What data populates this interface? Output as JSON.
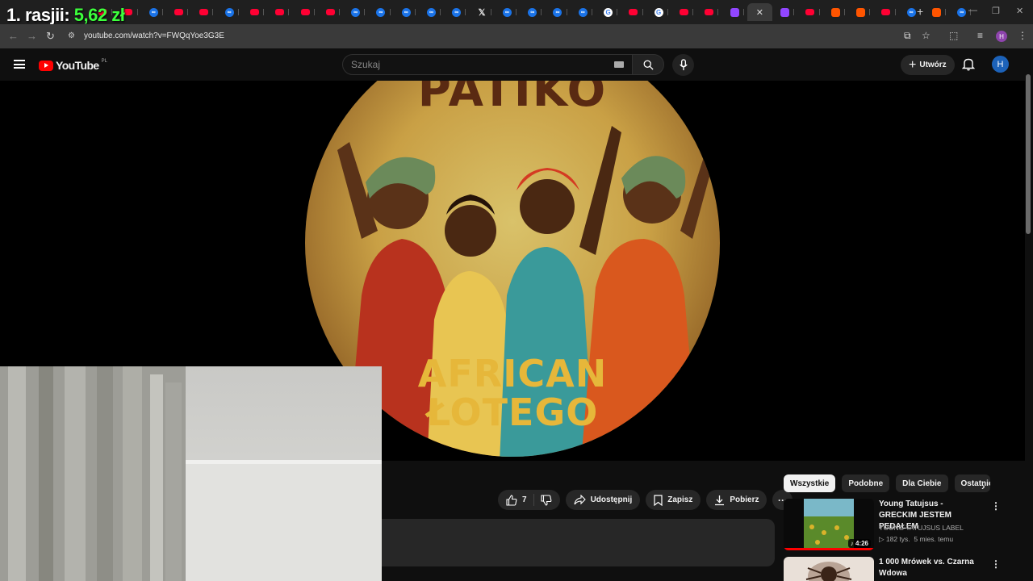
{
  "overlay": {
    "prefix": "1. rasjii: ",
    "amount": "5,62 zł"
  },
  "browser": {
    "tab_favicons": [
      "youtube",
      "youtube",
      "ms",
      "youtube",
      "youtube",
      "ms",
      "youtube",
      "youtube",
      "youtube",
      "youtube",
      "ms",
      "ms",
      "ms",
      "ms",
      "ms",
      "x",
      "ms",
      "ms",
      "ms",
      "ms",
      "google",
      "youtube",
      "google",
      "youtube",
      "youtube",
      "twitch",
      "active",
      "twitch",
      "youtube",
      "soundcloud",
      "soundcloud",
      "youtube",
      "ms",
      "soundcloud",
      "ms"
    ],
    "url": "youtube.com/watch?v=FWQqYoe3G3E"
  },
  "youtube": {
    "logo_text": "YouTube",
    "country_code": "PL",
    "search_placeholder": "Szukaj",
    "create_label": "Utwórz",
    "avatar_initial": "H"
  },
  "video": {
    "cover_top_text": "PATIKO",
    "cover_bottom_line1": "AFRICAN",
    "cover_bottom_line2": "ŁOTEGO"
  },
  "actions": {
    "like_count": "7",
    "share_label": "Udostępnij",
    "save_label": "Zapisz",
    "download_label": "Pobierz"
  },
  "chips": [
    "Wszystkie",
    "Podobne",
    "Dla Ciebie",
    "Ostatnio"
  ],
  "recommendations": [
    {
      "title": "Young Tatujsus - GRECKIM JESTEM PEDAŁEM",
      "channel": "YOUNG TATUJSUS LABEL",
      "views": "▷ 182 tys.",
      "age": "5 mies. temu",
      "duration": "♪ 4:26"
    },
    {
      "title": "1 000 Mrówek vs. Czarna Wdowa",
      "channel": "",
      "views": "",
      "age": "",
      "duration": ""
    }
  ],
  "colors": {
    "accent": "#ff0000",
    "money": "#3cff3c",
    "avatar": "#1c62b9"
  }
}
